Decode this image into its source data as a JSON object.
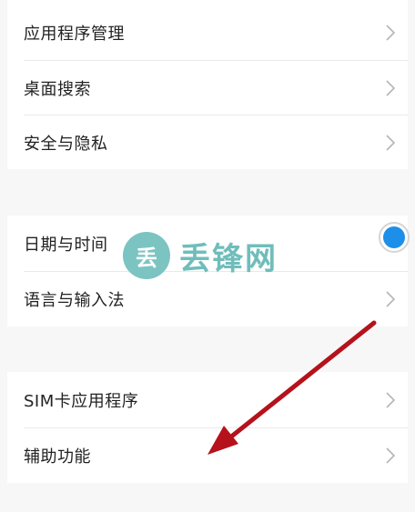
{
  "settings": {
    "group1": [
      {
        "label": "应用程序管理"
      },
      {
        "label": "桌面搜索"
      },
      {
        "label": "安全与隐私"
      }
    ],
    "group2": [
      {
        "label": "日期与时间"
      },
      {
        "label": "语言与输入法"
      }
    ],
    "group3": [
      {
        "label": "SIM卡应用程序"
      },
      {
        "label": "辅助功能"
      }
    ]
  },
  "watermark": {
    "logo_char": "丢",
    "text": "丢锋网"
  },
  "colors": {
    "annotation_arrow": "#b5121b",
    "toggle_dot": "#1e8fe8",
    "watermark": "#6fbdbb"
  }
}
